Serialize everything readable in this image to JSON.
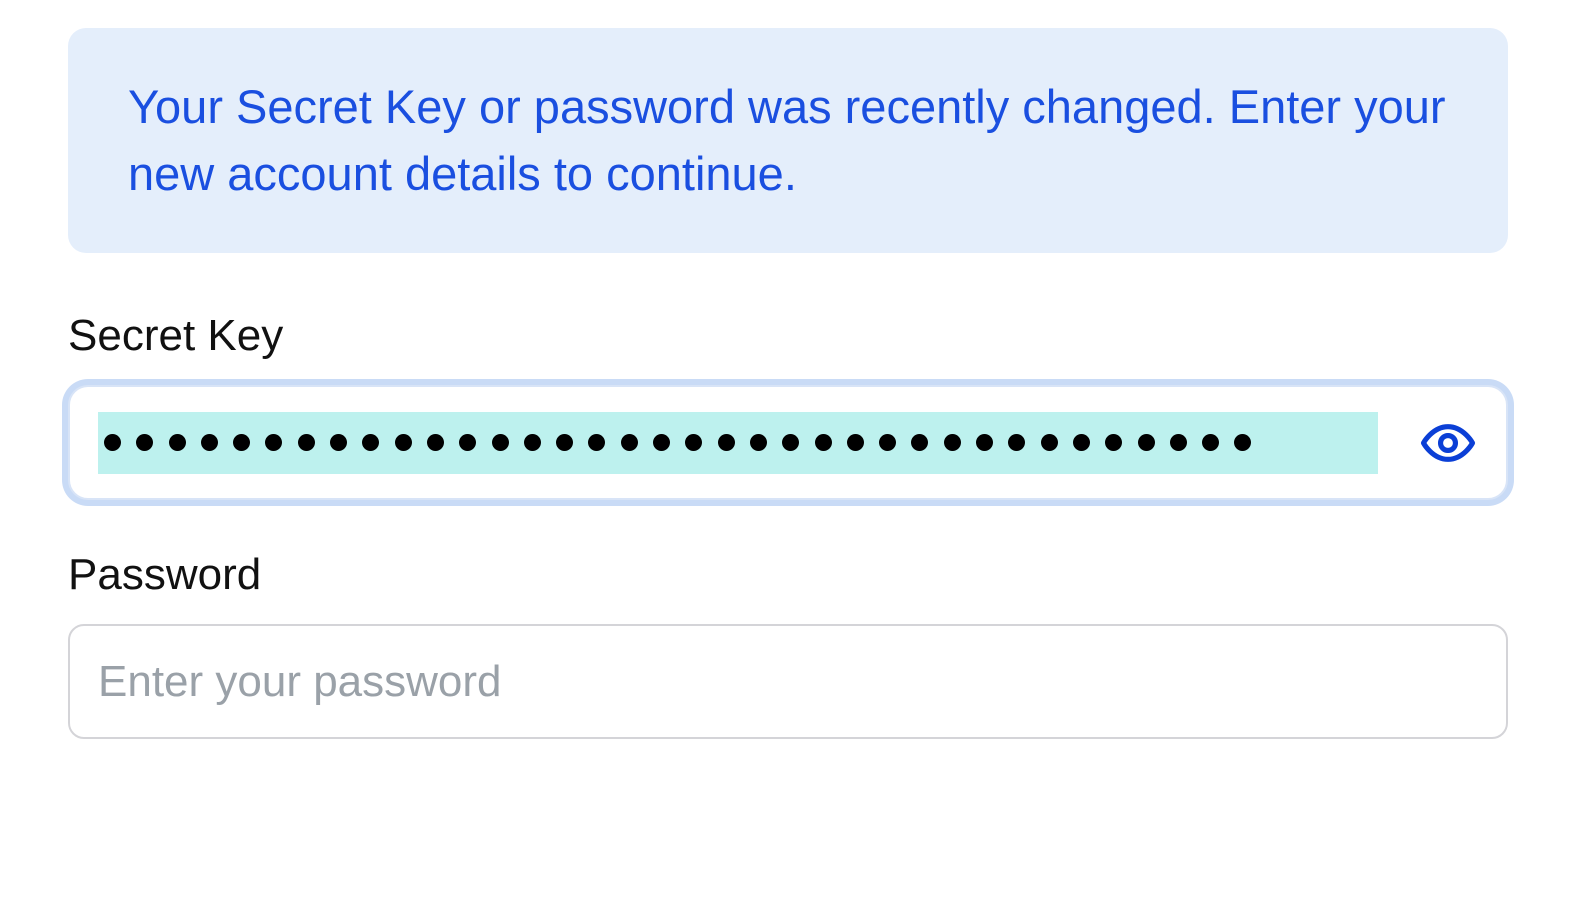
{
  "notice": {
    "message": "Your Secret Key or password was recently changed. Enter your new account details to continue."
  },
  "secret_key": {
    "label": "Secret Key",
    "masked_length": 36,
    "value": "",
    "focused": true,
    "autofill_highlight": true
  },
  "password": {
    "label": "Password",
    "placeholder": "Enter your password",
    "value": ""
  },
  "colors": {
    "notice_bg": "#e4eefb",
    "notice_text": "#1a4fe0",
    "focus_ring": "#c9dbf6",
    "autofill_bg": "#bdf1ee",
    "eye_icon": "#0b3fd6"
  }
}
